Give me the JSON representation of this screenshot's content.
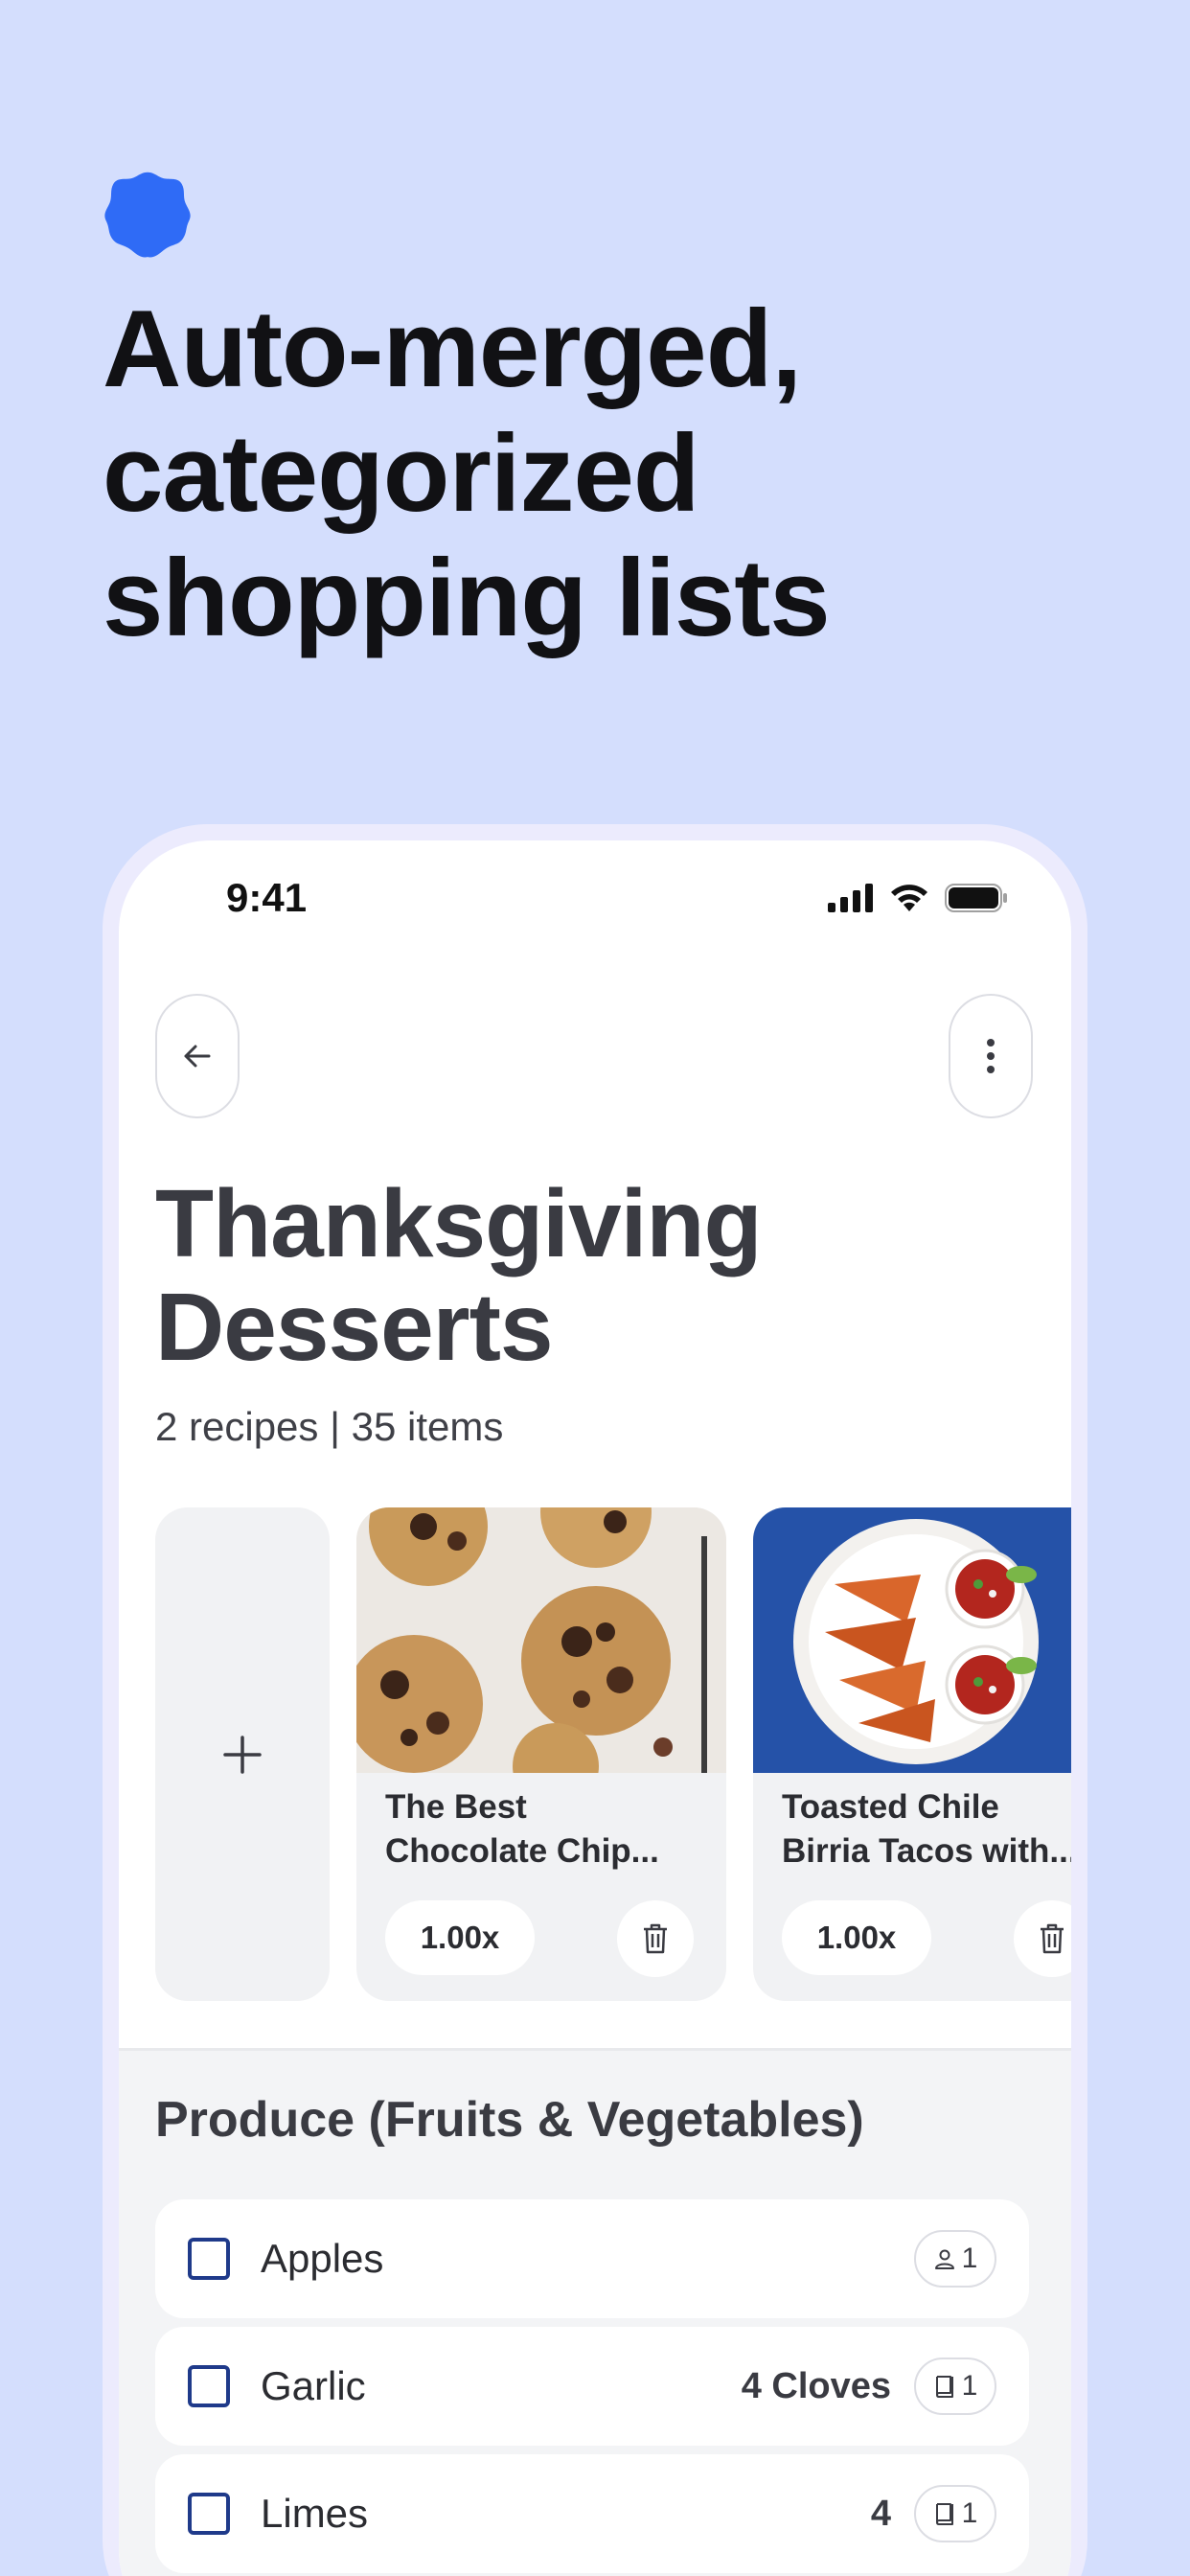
{
  "headline": "Auto-merged,\ncategorized\nshopping lists",
  "status_bar": {
    "time": "9:41"
  },
  "list": {
    "title": "Thanksgiving\nDesserts",
    "meta": "2 recipes | 35 items"
  },
  "recipes": [
    {
      "name_line1": "The Best",
      "name_line2": "Chocolate Chip...",
      "scale": "1.00x"
    },
    {
      "name_line1": "Toasted Chile",
      "name_line2": "Birria Tacos with...",
      "scale": "1.00x"
    }
  ],
  "section": {
    "title": "Produce (Fruits & Vegetables)"
  },
  "items": [
    {
      "name": "Apples",
      "qty": "",
      "chip_count": "1",
      "chip_icon": "person-icon"
    },
    {
      "name": "Garlic",
      "qty": "4 Cloves",
      "chip_count": "1",
      "chip_icon": "book-icon"
    },
    {
      "name": "Limes",
      "qty": "4",
      "chip_count": "1",
      "chip_icon": "book-icon"
    }
  ],
  "colors": {
    "background": "#d4defd",
    "accent_blob": "#2f6bf6",
    "checkbox": "#1f3a8a"
  }
}
